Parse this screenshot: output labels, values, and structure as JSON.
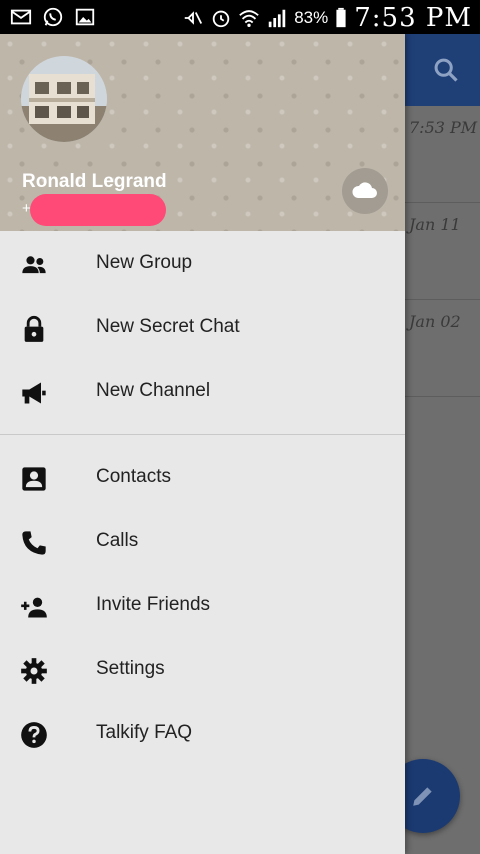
{
  "status_bar": {
    "battery": "83%",
    "time": "7:53 PM",
    "icons": [
      "email-icon",
      "whatsapp-icon",
      "image-icon",
      "mute-icon",
      "alarm-icon",
      "wifi-icon",
      "signal-icon",
      "battery-icon"
    ]
  },
  "background_app": {
    "toolbar_color": "#1f3f77",
    "rows": [
      {
        "date": "7:53 PM"
      },
      {
        "date": "Jan 11"
      },
      {
        "date": "Jan 02"
      }
    ],
    "fab_icon": "pencil-icon"
  },
  "drawer": {
    "header": {
      "name": "Ronald Legrand",
      "phone_prefix": "+",
      "cloud_icon": "cloud-icon"
    },
    "items": [
      {
        "label": "New Group",
        "icon": "group-icon"
      },
      {
        "label": "New Secret Chat",
        "icon": "lock-icon"
      },
      {
        "label": "New Channel",
        "icon": "megaphone-icon"
      },
      {
        "label": "Contacts",
        "icon": "contact-card-icon"
      },
      {
        "label": "Calls",
        "icon": "phone-icon"
      },
      {
        "label": "Invite Friends",
        "icon": "add-person-icon"
      },
      {
        "label": "Settings",
        "icon": "gear-icon"
      },
      {
        "label": "Talkify FAQ",
        "icon": "help-icon"
      }
    ]
  }
}
